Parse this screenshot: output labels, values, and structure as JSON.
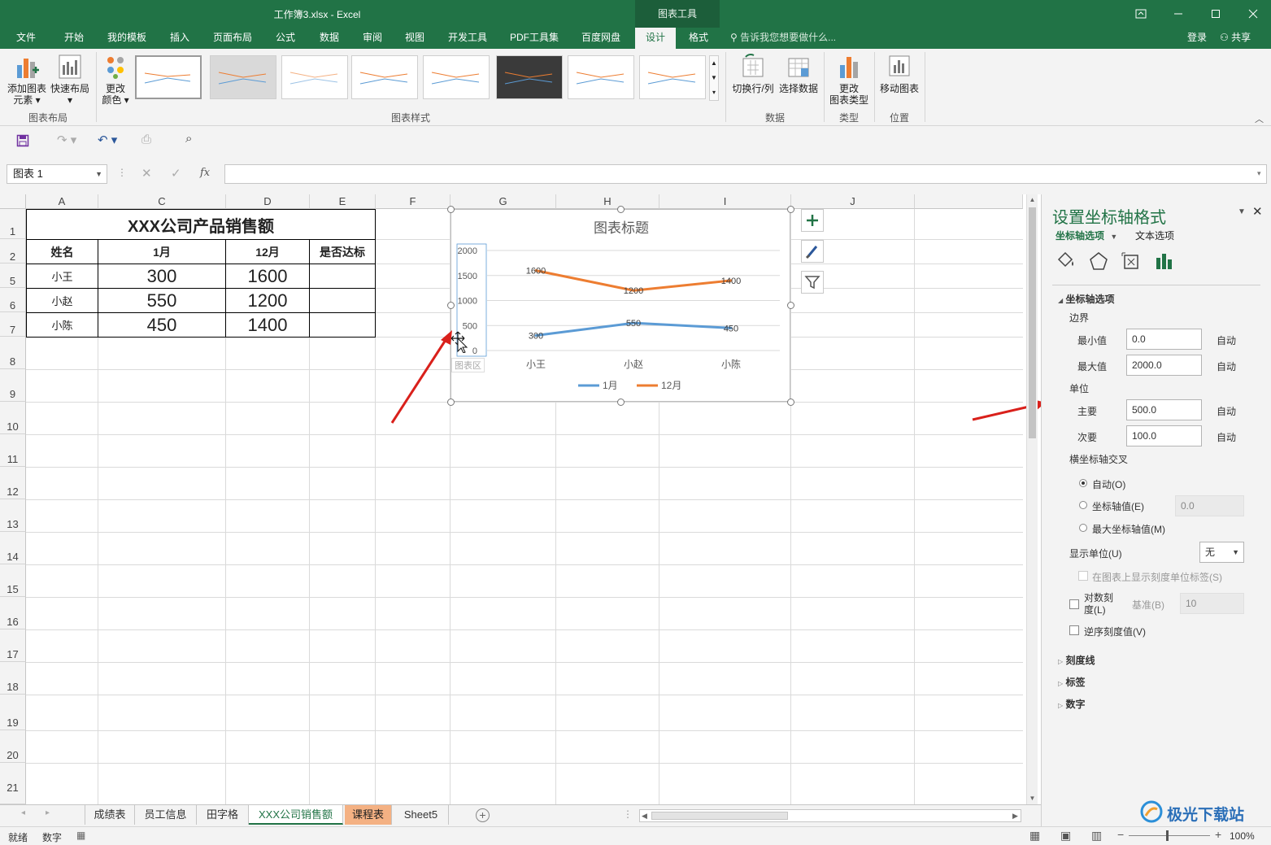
{
  "window": {
    "title": "工作簿3.xlsx - Excel",
    "context_tab_group": "图表工具",
    "buttons": [
      "restore-ribbon",
      "minimize",
      "maximize",
      "close"
    ]
  },
  "ribbon_tabs": [
    "文件",
    "开始",
    "我的模板",
    "插入",
    "页面布局",
    "公式",
    "数据",
    "审阅",
    "视图",
    "开发工具",
    "PDF工具集",
    "百度网盘",
    "设计",
    "格式"
  ],
  "active_tab": "设计",
  "tell_me": "告诉我您想要做什么...",
  "account": {
    "login": "登录",
    "share": "共享"
  },
  "ribbon": {
    "groups": {
      "layout": "图表布局",
      "styles": "图表样式",
      "data": "数据",
      "type": "类型",
      "location": "位置"
    },
    "add_element": "添加图表\n元素",
    "add_element_l1": "添加图表",
    "add_element_l2": "元素",
    "quick_layout": "快速布局",
    "change_colors_l1": "更改",
    "change_colors_l2": "颜色",
    "switch_row_col": "切换行/列",
    "select_data": "选择数据",
    "change_type_l1": "更改",
    "change_type_l2": "图表类型",
    "move_chart": "移动图表"
  },
  "name_box": "图表 1",
  "columns": [
    "A",
    "C",
    "D",
    "E",
    "F",
    "G",
    "H",
    "I",
    "J"
  ],
  "rows": [
    "1",
    "2",
    "5",
    "6",
    "7",
    "8",
    "9",
    "10",
    "11",
    "12",
    "13",
    "14",
    "15",
    "16",
    "17",
    "18",
    "19",
    "20",
    "21"
  ],
  "table": {
    "title": "XXX公司产品销售额",
    "headers": [
      "姓名",
      "1月",
      "12月",
      "是否达标"
    ],
    "rows": [
      [
        "小王",
        "300",
        "1600",
        ""
      ],
      [
        "小赵",
        "550",
        "1200",
        ""
      ],
      [
        "小陈",
        "450",
        "1400",
        ""
      ]
    ]
  },
  "chart_data": {
    "type": "line",
    "title": "图表标题",
    "categories": [
      "小王",
      "小赵",
      "小陈"
    ],
    "series": [
      {
        "name": "1月",
        "values": [
          300,
          550,
          450
        ],
        "color": "#5b9bd5"
      },
      {
        "name": "12月",
        "values": [
          1600,
          1200,
          1400
        ],
        "color": "#ed7d31"
      }
    ],
    "ylim": [
      0,
      2000
    ],
    "yticks": [
      "2000",
      "1500",
      "1000",
      "500",
      "0"
    ],
    "gridlines": true,
    "legend_position": "bottom",
    "plot_area_tooltip": "图表区"
  },
  "sheet_tabs": [
    "成绩表",
    "员工信息",
    "田字格",
    "XXX公司销售额",
    "课程表",
    "Sheet5"
  ],
  "active_sheet": "XXX公司销售额",
  "status": {
    "ready": "就绪",
    "mode": "数字",
    "zoom": "100%"
  },
  "pane": {
    "title": "设置坐标轴格式",
    "tab_axis_options": "坐标轴选项",
    "tab_text_options": "文本选项",
    "section_axis_options": "坐标轴选项",
    "bounds_label": "边界",
    "min_label": "最小值",
    "min_value": "0.0",
    "max_label": "最大值",
    "max_value": "2000.0",
    "auto": "自动",
    "units_label": "单位",
    "major_label": "主要",
    "major_value": "500.0",
    "minor_label": "次要",
    "minor_value": "100.0",
    "cross_label": "横坐标轴交叉",
    "cross_auto": "自动(O)",
    "cross_value": "坐标轴值(E)",
    "cross_value_input": "0.0",
    "cross_max": "最大坐标轴值(M)",
    "display_units": "显示单位(U)",
    "display_units_value": "无",
    "show_units_label": "在图表上显示刻度单位标签(S)",
    "log_scale_l1": "对数刻",
    "log_scale_l2": "度(L)",
    "log_base": "基准(B)",
    "log_base_value": "10",
    "reverse": "逆序刻度值(V)",
    "tick_marks": "刻度线",
    "labels": "标签",
    "number": "数字"
  },
  "watermark": "极光下载站"
}
